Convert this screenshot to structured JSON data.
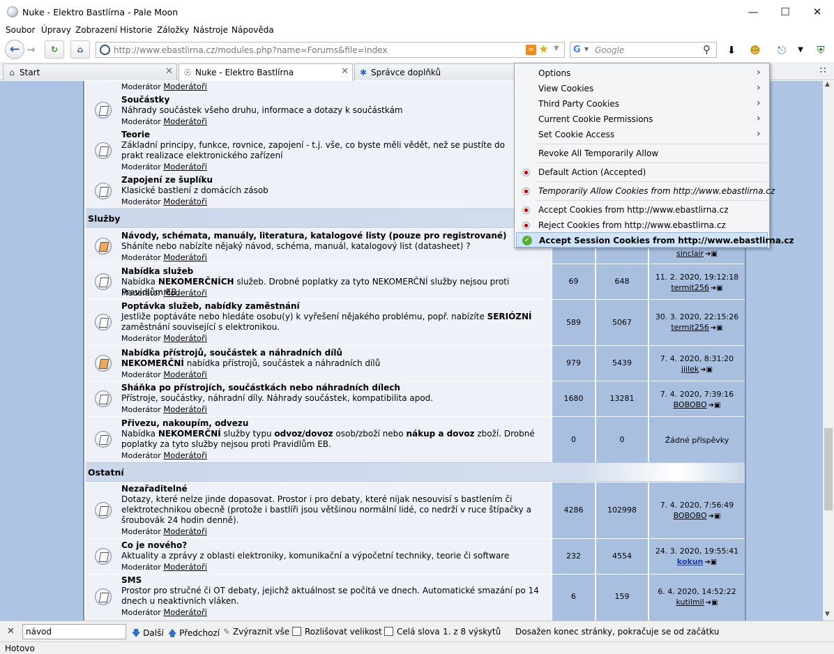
{
  "window": {
    "title": "Nuke - Elektro Bastlírna - Pale Moon"
  },
  "menu": [
    "Soubor",
    "Úpravy",
    "Zobrazení",
    "Historie",
    "Záložky",
    "Nástroje",
    "Nápověda"
  ],
  "nav": {
    "url": "http://www.ebastlirna.cz/modules.php?name=Forums&file=index",
    "search_placeholder": "Google"
  },
  "tabs": [
    {
      "label": "Start"
    },
    {
      "label": "Nuke - Elektro Bastlírna"
    },
    {
      "label": "Správce doplňků"
    }
  ],
  "forum": {
    "moderator_label": "Moderátor",
    "moderator_link": "Moderátoři",
    "top_partial_moderator": "Moderátor",
    "sections": [
      {
        "name": "",
        "forums": [
          {
            "title": "Součástky",
            "desc": "Náhrady součástek všeho druhu, informace a dotazy k součástkám"
          },
          {
            "title": "Teorie",
            "desc": "Základní principy, funkce, rovnice, zapojení - t.j. vše, co byste měli vědět, než se pustíte do prakt realizace elektronického zařízení"
          },
          {
            "title": "Zapojení ze šuplíku",
            "desc": "Klasické bastlení z domácích zásob"
          }
        ]
      },
      {
        "name": "Služby",
        "forums": [
          {
            "title": "Návody, schémata, manuály, literatura, katalogové listy (pouze pro registrované)",
            "desc": "Sháníte nebo nabízíte nějaký návod, schéma, manuál, katalogový list (datasheet) ?",
            "last_user": "sinclair"
          },
          {
            "title": "Nabídka služeb",
            "desc_parts": [
              "Nabídka ",
              "NEKOMERČNÍCH",
              " služeb. Drobné poplatky za tyto NEKOMERČNÍ služby nejsou proti Pravidlům EB."
            ],
            "topics": "69",
            "posts": "648",
            "last_date": "11. 2. 2020, 19:12:18",
            "last_user": "termit256"
          },
          {
            "title": "Poptávka služeb, nabídky zaměstnání",
            "desc_parts": [
              "Jestliže poptáváte nebo hledáte osobu(y) k vyřešení nějakého problému, popř. nabízíte ",
              "SERIÓZNÍ",
              " zaměstnání související s elektronikou."
            ],
            "topics": "589",
            "posts": "5067",
            "last_date": "30. 3. 2020, 22:15:26",
            "last_user": "termit256"
          },
          {
            "title": "Nabídka přístrojů, součástek a náhradních dílů",
            "desc_parts": [
              "NEKOMERČNÍ",
              " nabídka přístrojů, součástek a náhradních dílů"
            ],
            "topics": "979",
            "posts": "5439",
            "last_date": "7. 4. 2020, 8:31:20",
            "last_user": "jjilek"
          },
          {
            "title": "Sháňka po přístrojích, součástkách nebo náhradních dílech",
            "desc": "Přístroje, součástky, náhradní díly. Náhrady součástek, kompatibilita apod.",
            "topics": "1680",
            "posts": "13281",
            "last_date": "7. 4. 2020, 7:39:16",
            "last_user": "BOBOBO"
          },
          {
            "title": "Přivezu, nakoupím, odvezu",
            "desc_parts": [
              "Nabídka ",
              "NEKOMERČNÍ",
              " služby typu ",
              "odvoz/dovoz",
              " osob/zboží nebo ",
              "nákup a dovoz",
              " zboží. Drobné poplatky za tyto služby nejsou proti Pravidlům EB."
            ],
            "topics": "0",
            "posts": "0",
            "last_none": "Žádné příspěvky"
          }
        ]
      },
      {
        "name": "Ostatní",
        "forums": [
          {
            "title": "Nezařaditelné",
            "desc": "Dotazy, které nelze jinde dopasovat. Prostor i pro debaty, které nijak nesouvisí s bastlením či elektrotechnikou obecně (protože i bastlíři jsou většinou normální lidé, co nedrží v ruce štípačky a šroubovák 24 hodin denně).",
            "topics": "4286",
            "posts": "102998",
            "last_date": "7. 4. 2020, 7:56:49",
            "last_user": "BOBOBO"
          },
          {
            "title": "Co je nového?",
            "desc": "Aktuality a zprávy z oblasti elektroniky, komunikační a výpočetní techniky, teorie či software",
            "topics": "232",
            "posts": "4554",
            "last_date": "24. 3. 2020, 19:55:41",
            "last_user": "kokun"
          },
          {
            "title": "SMS",
            "desc": "Prostor pro stručné či OT debaty, jejichž aktuálnost se počítá ve dnech. Automatické smazání po 14 dnech u neaktivních vláken.",
            "topics": "6",
            "posts": "159",
            "last_date": "6. 4. 2020, 14:52:22",
            "last_user": "kutilmil"
          }
        ]
      }
    ]
  },
  "cookie_menu": {
    "items": [
      "Options",
      "View Cookies",
      "Third Party Cookies",
      "Current Cookie Permissions",
      "Set Cookie Access",
      "Revoke All Temporarily Allow",
      "Default Action (Accepted)",
      "Temporarily Allow Cookies from http://www.ebastlirna.cz",
      "Accept Cookies from http://www.ebastlirna.cz",
      "Reject Cookies from http://www.ebastlirna.cz",
      "Accept Session Cookies from http://www.ebastlirna.cz"
    ]
  },
  "findbar": {
    "query": "návod",
    "next": "Další",
    "prev": "Předchozí",
    "highlight": "Zvýraznit vše",
    "match_case": "Rozlišovat velikost",
    "whole_words": "Celá slova",
    "count": "1. z 8 výskytů",
    "status": "Dosažen konec stránky, pokračuje se od začátku"
  },
  "statusbar": {
    "text": "Hotovo"
  }
}
